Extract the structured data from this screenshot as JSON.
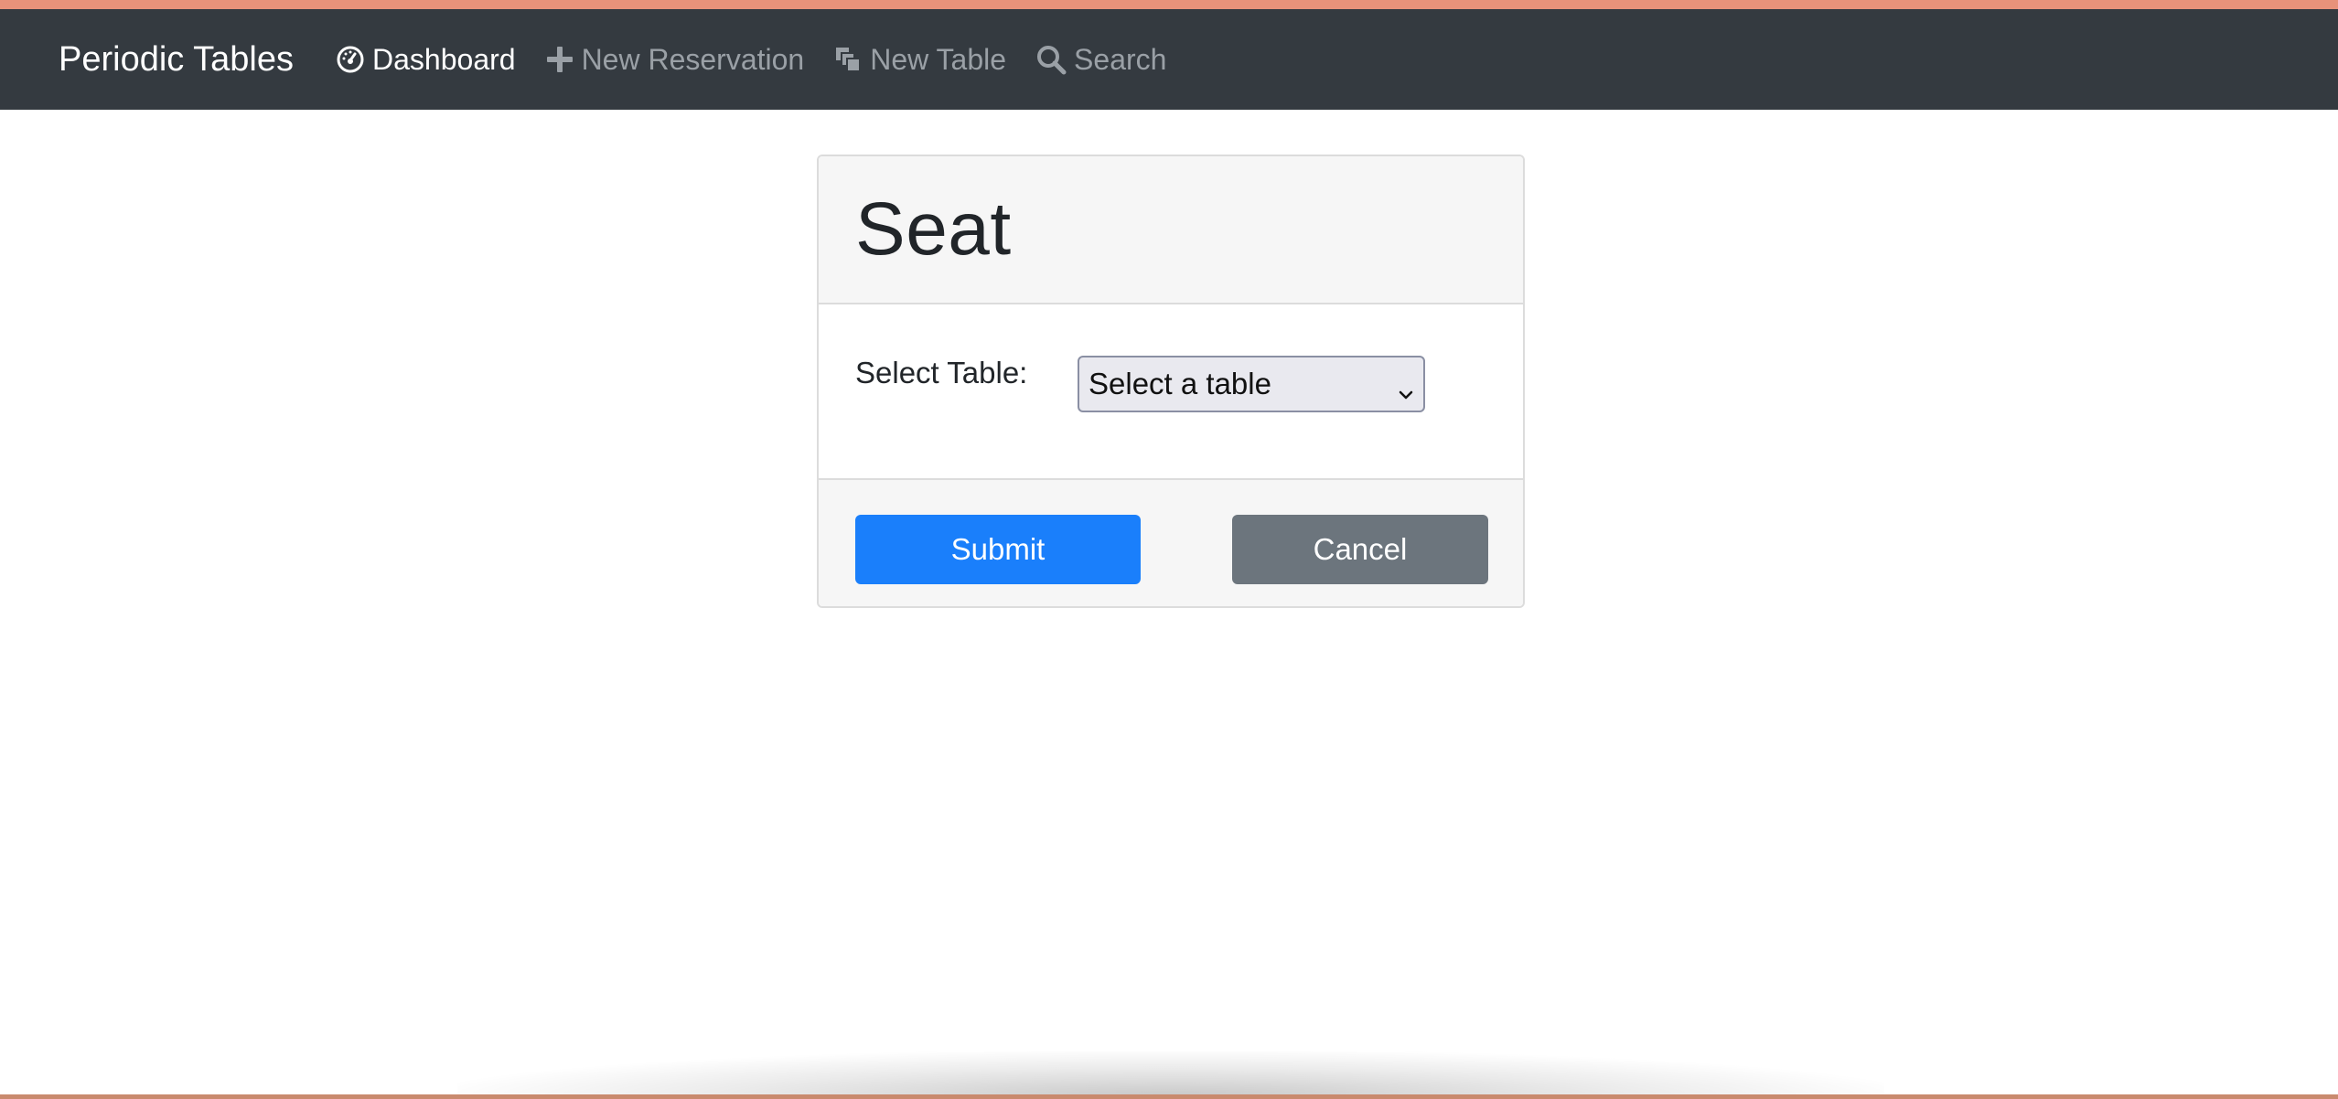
{
  "navbar": {
    "brand": "Periodic Tables",
    "items": [
      {
        "label": "Dashboard",
        "icon": "dashboard-icon",
        "active": true
      },
      {
        "label": "New Reservation",
        "icon": "plus-icon",
        "active": false
      },
      {
        "label": "New Table",
        "icon": "layers-icon",
        "active": false
      },
      {
        "label": "Search",
        "icon": "search-icon",
        "active": false
      }
    ]
  },
  "card": {
    "title": "Seat",
    "select_label": "Select Table:",
    "select_value": "Select a table",
    "submit_label": "Submit",
    "cancel_label": "Cancel"
  },
  "colors": {
    "navbar_bg": "#343a40",
    "primary": "#1a7ffb",
    "secondary": "#6c757d",
    "accent": "#e8927a"
  }
}
